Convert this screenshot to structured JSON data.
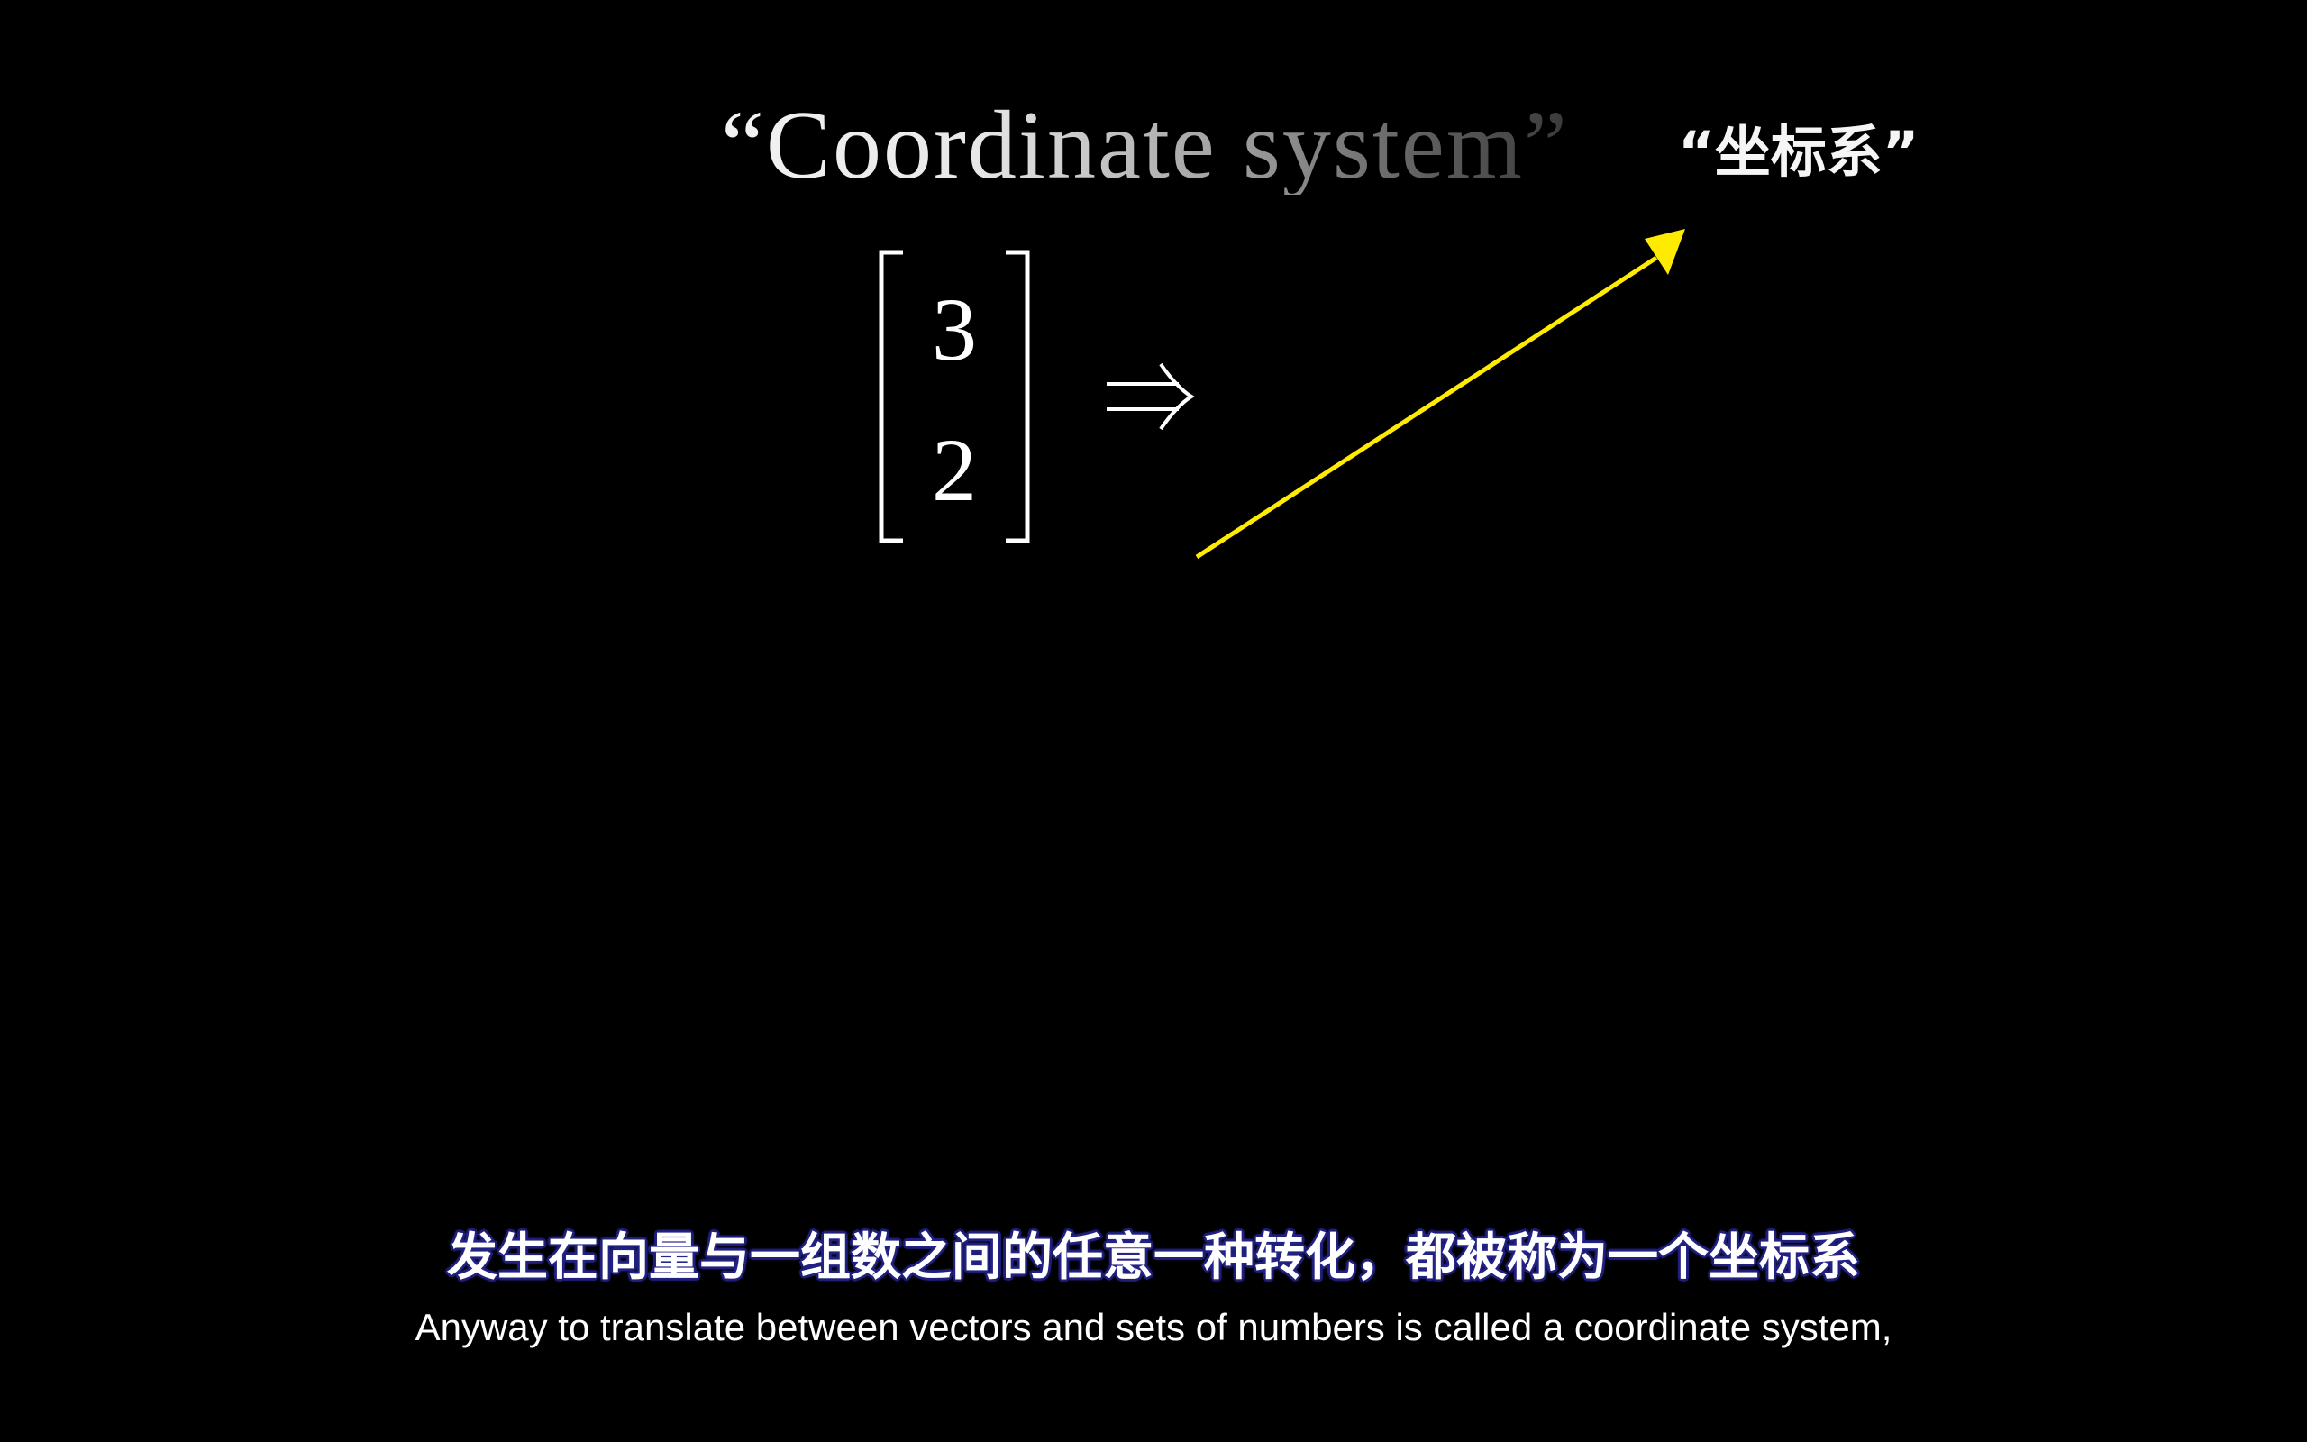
{
  "title": {
    "english": "“Coordinate system”",
    "chinese": "“坐标系”"
  },
  "vector_notation": {
    "top_entry": "3",
    "bottom_entry": "2",
    "arrow_symbol": "⇒"
  },
  "vector_arrow": {
    "color": "#ffeb00"
  },
  "subtitles": {
    "chinese": "发生在向量与一组数之间的任意一种转化，都被称为一个坐标系",
    "english": "Anyway to translate between vectors and sets of numbers is called a coordinate system,"
  }
}
